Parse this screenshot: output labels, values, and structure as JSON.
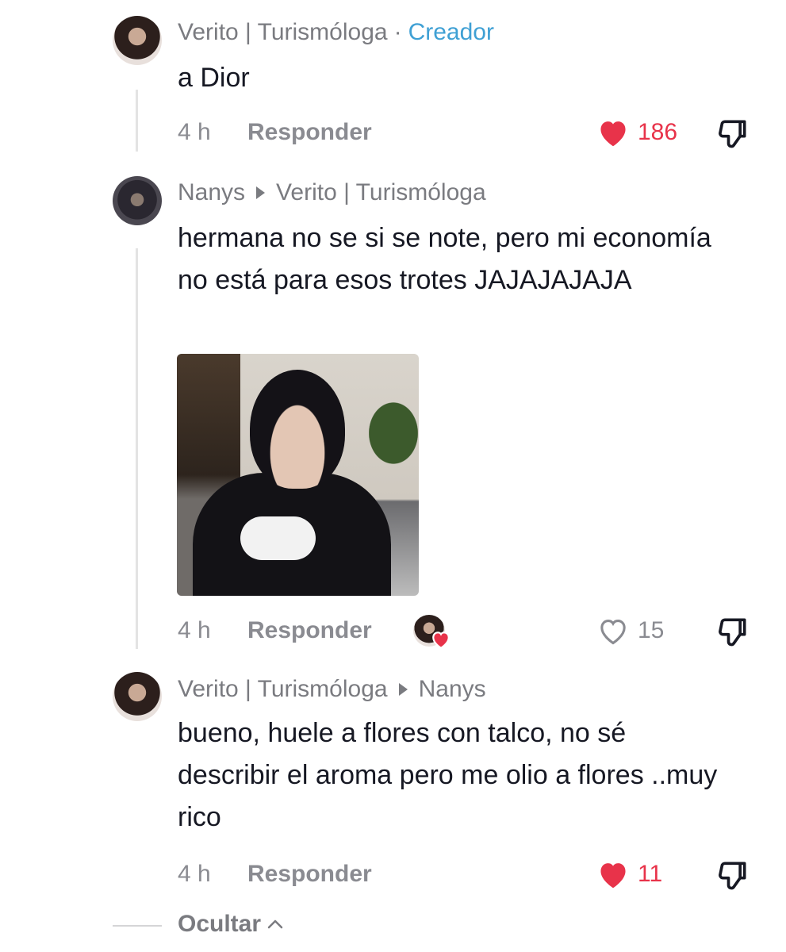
{
  "comments": [
    {
      "author": "Verito | Turismóloga",
      "separator": "·",
      "badge": "Creador",
      "text": "a Dior",
      "time": "4 h",
      "reply_label": "Responder",
      "likes": "186",
      "liked": true
    },
    {
      "author": "Nanys",
      "reply_to": "Verito | Turismóloga",
      "text": "hermana no se si se note, pero mi economía no está para esos trotes JAJAJAJAJA",
      "time": "4 h",
      "reply_label": "Responder",
      "likes": "15",
      "liked": false,
      "creator_liked": true
    },
    {
      "author": "Verito | Turismóloga",
      "reply_to": "Nanys",
      "text": "bueno, huele a flores con talco, no sé describir el aroma pero me olio a flores ..muy rico",
      "time": "4 h",
      "reply_label": "Responder",
      "likes": "11",
      "liked": true
    }
  ],
  "hide_label": "Ocultar",
  "colors": {
    "like_red": "#e8334a",
    "creator_blue": "#3fa0d4",
    "muted_gray": "#8a8b91"
  },
  "icons": [
    "heart-filled-icon",
    "heart-outline-icon",
    "dislike-icon",
    "chevron-up-icon",
    "reply-arrow-icon"
  ]
}
